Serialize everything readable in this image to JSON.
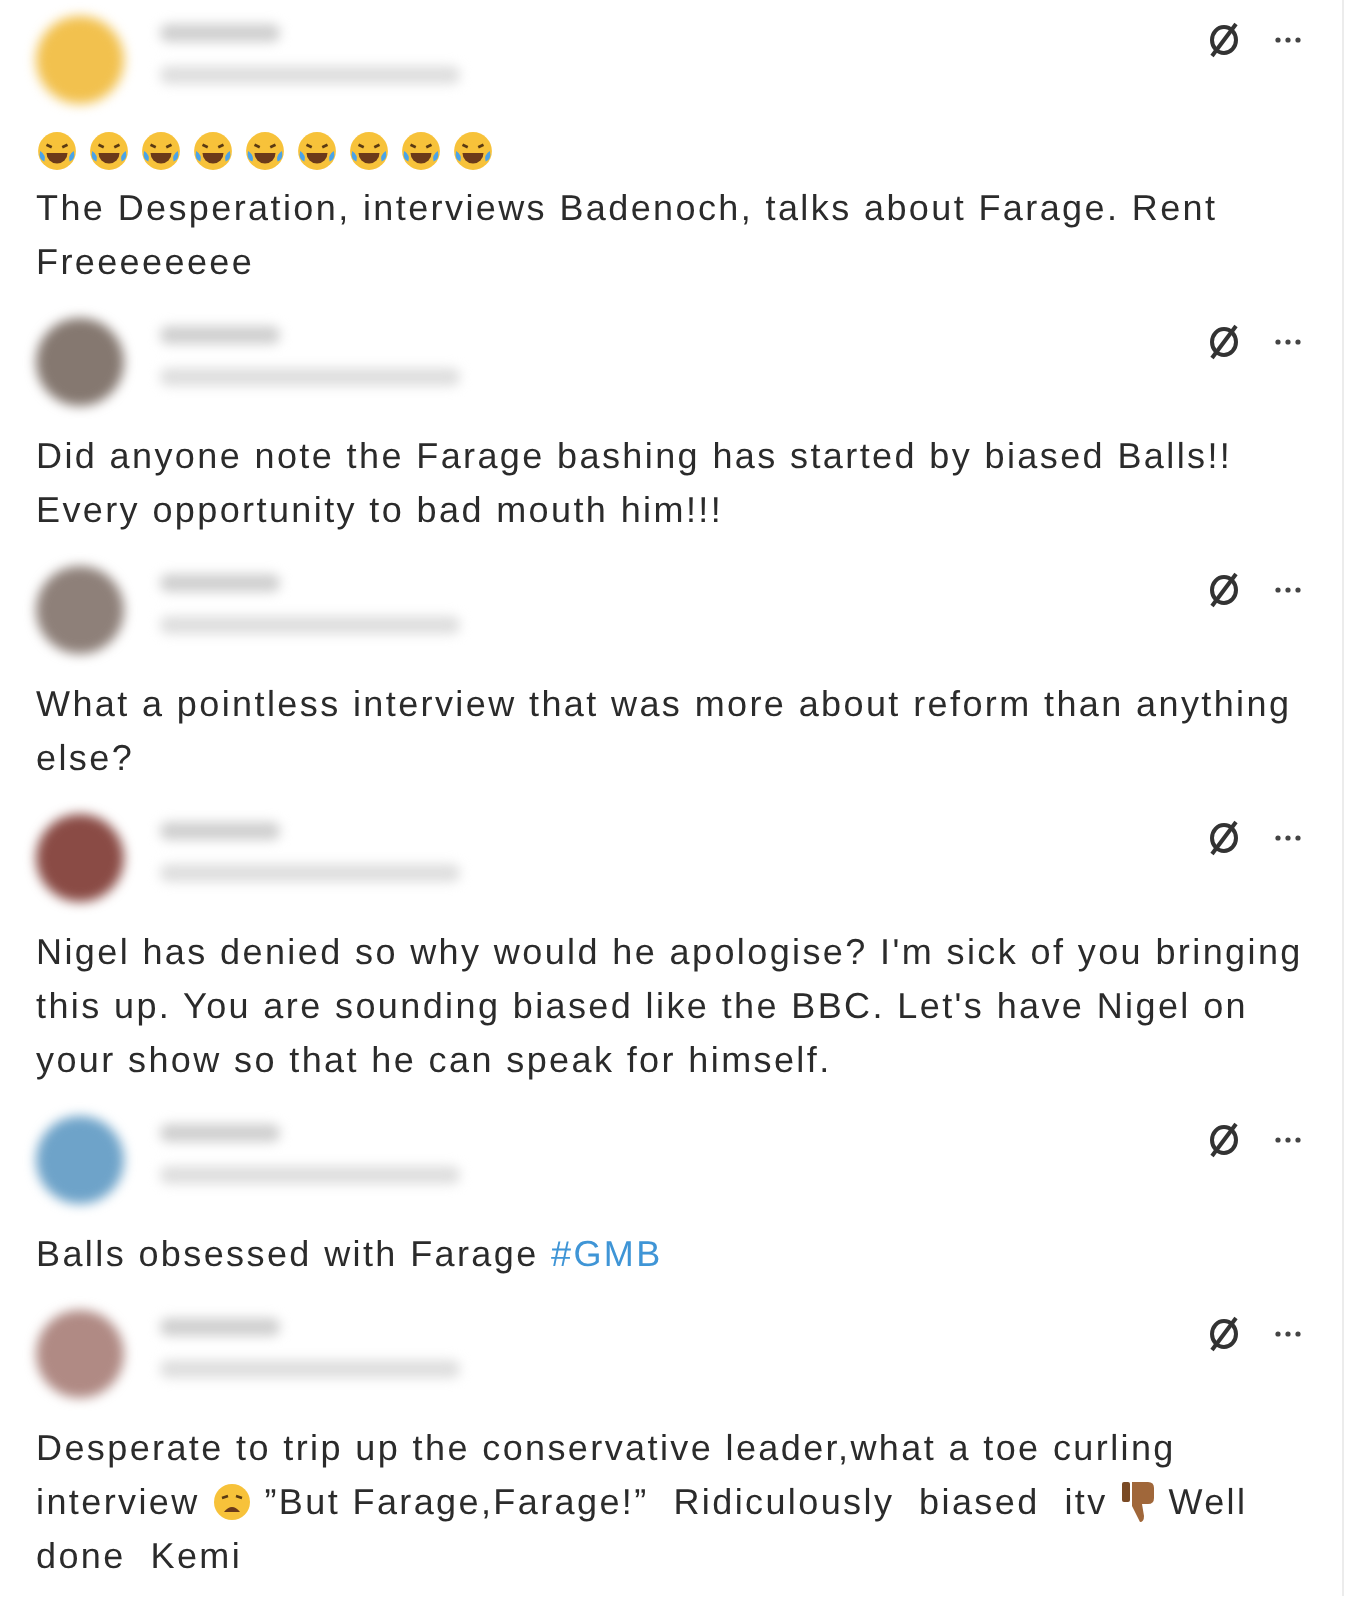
{
  "posts": [
    {
      "color": "#f2c14e",
      "body": [
        {
          "kind": "laughing-face"
        },
        {
          "kind": "laughing-face"
        },
        {
          "kind": "laughing-face"
        },
        {
          "kind": "laughing-face"
        },
        {
          "kind": "laughing-face"
        },
        {
          "kind": "laughing-face"
        },
        {
          "kind": "laughing-face"
        },
        {
          "kind": "laughing-face"
        },
        {
          "kind": "laughing-face"
        },
        {
          "kind": "break"
        },
        {
          "kind": "text",
          "text": "The Desperation, interviews Badenoch, talks about Farage. Rent Freeeeeeee"
        }
      ]
    },
    {
      "color": "#857870",
      "body": [
        {
          "kind": "text",
          "text": "Did anyone note the Farage bashing has started by biased Balls!! Every opportunity to bad mouth him!!!"
        }
      ]
    },
    {
      "color": "#8e8079",
      "body": [
        {
          "kind": "text",
          "text": "What a pointless interview that was more about reform than anything else?"
        }
      ]
    },
    {
      "color": "#8a4b45",
      "body": [
        {
          "kind": "text",
          "text": "Nigel has denied so why would he apologise? I'm sick of you bringing this up. You are sounding biased like the BBC. Let's have Nigel on your show so that he can speak for himself."
        }
      ]
    },
    {
      "color": "#6ea3c9",
      "body": [
        {
          "kind": "text",
          "text": "Balls obsessed with Farage "
        },
        {
          "kind": "hashtag",
          "text": "#GMB"
        }
      ]
    },
    {
      "color": "#b08a84",
      "body": [
        {
          "kind": "text",
          "text": "Desperate to trip up the conservative leader,what a toe curling interview "
        },
        {
          "kind": "weary-face"
        },
        {
          "kind": "text",
          "text": " ”But Farage,Farage!”  Ridiculously  biased  itv "
        },
        {
          "kind": "thumbs-down"
        },
        {
          "kind": "text",
          "text": " Well  done  Kemi"
        }
      ]
    }
  ]
}
